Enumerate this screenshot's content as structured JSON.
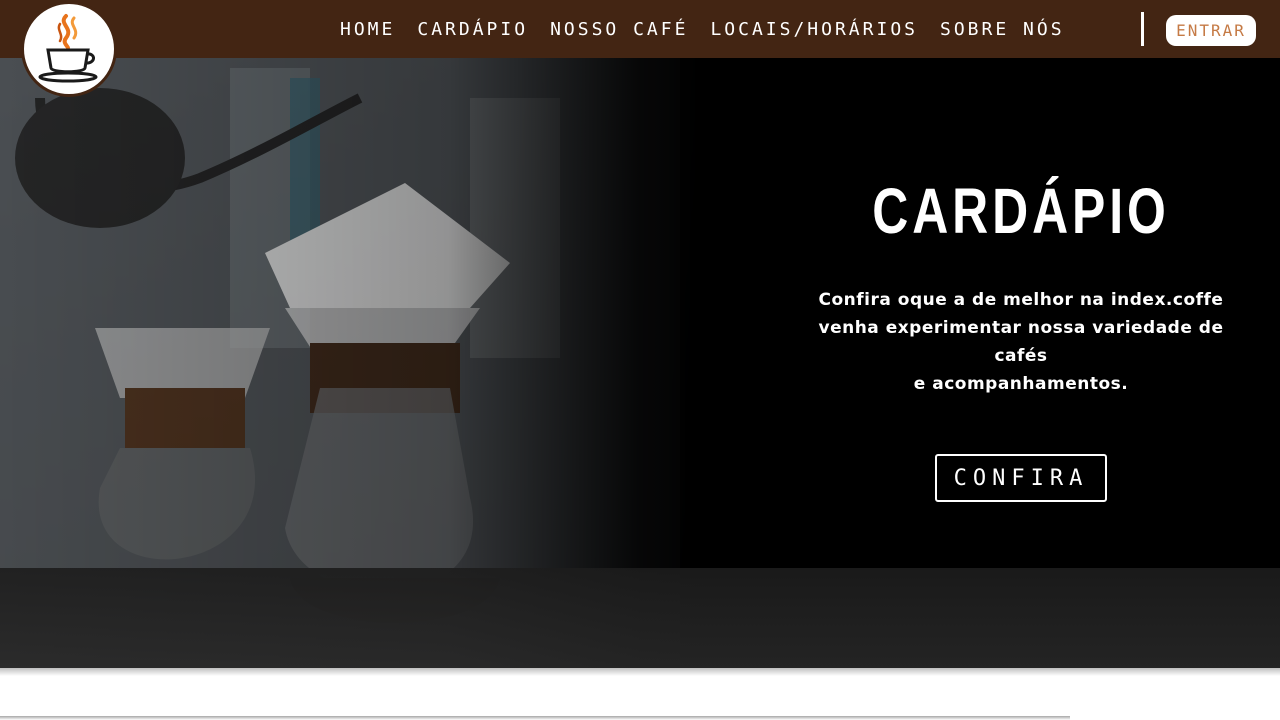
{
  "brand": {
    "logo_icon": "coffee-cup-icon"
  },
  "nav": {
    "items": [
      {
        "label": "HOME"
      },
      {
        "label": "CARDÁPIO"
      },
      {
        "label": "NOSSO CAFÉ"
      },
      {
        "label": "LOCAIS/HORÁRIOS"
      },
      {
        "label": "SOBRE NÓS"
      }
    ],
    "login_label": "ENTRAR"
  },
  "hero": {
    "title": "CARDÁPIO",
    "description_lines": [
      "Confira oque a de melhor na index.coffe",
      "venha experimentar nossa variedade de cafés",
      "e acompanhamentos."
    ],
    "cta_label": "CONFIRA"
  },
  "colors": {
    "navbar": "#432513",
    "accent": "#c57a45",
    "text": "#ffffff"
  }
}
